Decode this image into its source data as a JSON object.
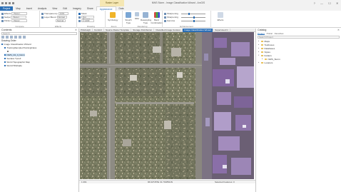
{
  "app": {
    "window_title": "NWS Storm - Image Classification Wizard - ArcGIS Pro",
    "context_tab_group": "Raster Layer",
    "window_buttons": [
      "?",
      "—",
      "☐",
      "✕"
    ]
  },
  "ribbon_tabs": [
    "Project",
    "Map",
    "Insert",
    "Analysis",
    "View",
    "Edit",
    "Imagery",
    "Share",
    "Appearance",
    "Data"
  ],
  "ribbon": {
    "effects_rows": [
      {
        "label": "Effects",
        "value": "<None>"
      },
      {
        "label": "Swipe",
        "value": "<None>"
      },
      {
        "label": "Flicker",
        "value": "<None>"
      }
    ],
    "transparency_rows": [
      {
        "label": "Transparency",
        "value": "0.0%"
      },
      {
        "label": "Layer Blend",
        "value": "Normal"
      },
      {
        "label": "",
        "value": "Normal"
      }
    ],
    "groups": [
      "Compare",
      "Effects",
      "Drawing",
      "Zoom",
      "Enhancement",
      "Rendering"
    ],
    "buttons": {
      "mask": "Mask",
      "min_scale": "Out Beyond",
      "symbology": "Symbology",
      "stretch_type": "Stretch Type",
      "dra": "DRA",
      "resampling_type": "Resampling Type",
      "band_combination": "Band Combination",
      "gamma": "Gamma"
    },
    "scale_value": "1:1,000",
    "enhancement_labels": [
      "Sharpening",
      "Sharpening",
      "Gamma",
      "Effects"
    ]
  },
  "contents": {
    "title": "Contents",
    "search_placeholder": "Search",
    "drawing_order": "Drawing Order",
    "items": [
      {
        "label": "Image Classification Wizard",
        "checked": true,
        "indent": 0,
        "highlight": false
      },
      {
        "label": "TrainingSamplesTrainingClass",
        "checked": true,
        "indent": 1,
        "highlight": false
      },
      {
        "label": "",
        "checked": false,
        "indent": 2,
        "highlight": false
      },
      {
        "label": "NWS_Clt_3_Norm",
        "checked": true,
        "indent": 1,
        "highlight": true
      },
      {
        "label": "Seclass Tpcoll",
        "checked": true,
        "indent": 1,
        "highlight": false
      },
      {
        "label": "World Topographic Map",
        "checked": true,
        "indent": 1,
        "highlight": false
      },
      {
        "label": "World Hillshade",
        "checked": true,
        "indent": 1,
        "highlight": false
      }
    ]
  },
  "map_tabs": [
    {
      "label": "Pittsburgh",
      "selected": false
    },
    {
      "label": "Comfort",
      "selected": false
    },
    {
      "label": "Source Raster Template",
      "selected": false
    },
    {
      "label": "Storage Distribution",
      "selected": false
    },
    {
      "label": "Classified Image Contour",
      "selected": false
    },
    {
      "label": "Image Classification Wizard",
      "selected": true
    },
    {
      "label": "Supervised C",
      "selected": false
    }
  ],
  "map_status": {
    "scale": "1:491",
    "coordinates": "96.927457E 31.7198541N",
    "selected": "Selected Features: 0"
  },
  "catalog": {
    "title": "Catalog",
    "tabs": [
      "Project",
      "Portal",
      "Favorites"
    ],
    "search_placeholder": "Search Project",
    "items": [
      {
        "label": "Maps",
        "indent": 0,
        "expanded": false
      },
      {
        "label": "Toolboxes",
        "indent": 0,
        "expanded": false
      },
      {
        "label": "Databases",
        "indent": 0,
        "expanded": false
      },
      {
        "label": "Styles",
        "indent": 0,
        "expanded": false
      },
      {
        "label": "Folders",
        "indent": 0,
        "expanded": true
      },
      {
        "label": "NWS_Storm",
        "indent": 1,
        "expanded": false
      },
      {
        "label": "Locators",
        "indent": 0,
        "expanded": false
      }
    ]
  },
  "colors": {
    "accent": "#2b6fb6",
    "context_tab": "#f5e7b3",
    "classified_purple": "#8a6fa8"
  }
}
